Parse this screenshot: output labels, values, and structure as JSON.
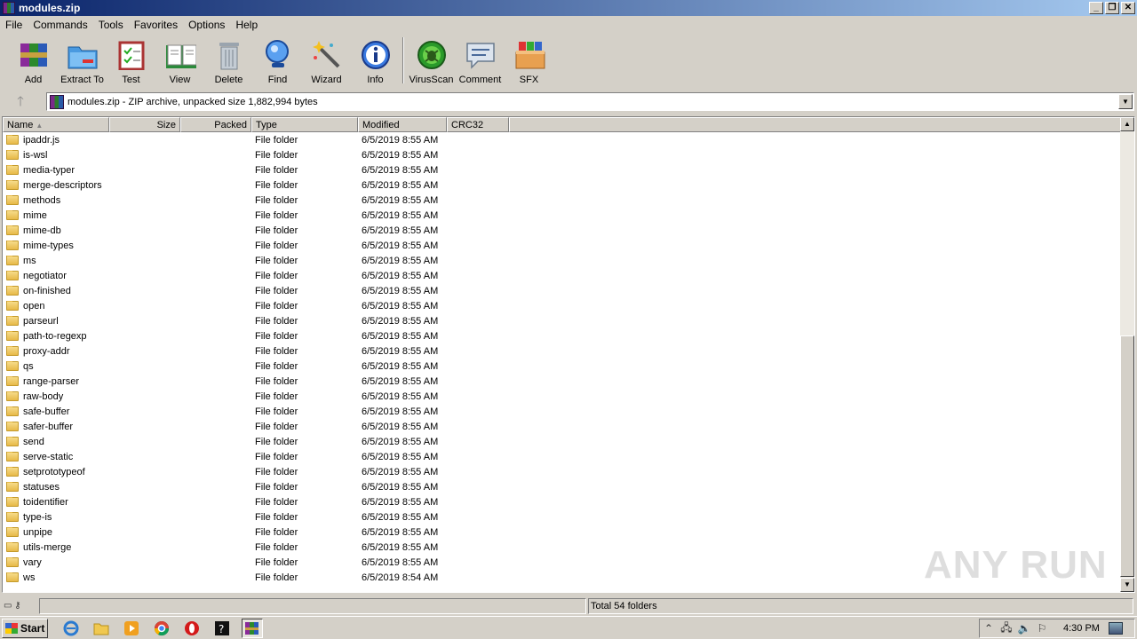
{
  "window": {
    "title": "modules.zip"
  },
  "menu": [
    "File",
    "Commands",
    "Tools",
    "Favorites",
    "Options",
    "Help"
  ],
  "toolbar": [
    {
      "label": "Add",
      "icon": "add-archive-icon"
    },
    {
      "label": "Extract To",
      "icon": "extract-folder-icon"
    },
    {
      "label": "Test",
      "icon": "test-checklist-icon"
    },
    {
      "label": "View",
      "icon": "view-book-icon"
    },
    {
      "label": "Delete",
      "icon": "trash-can-icon"
    },
    {
      "label": "Find",
      "icon": "magnifier-icon"
    },
    {
      "label": "Wizard",
      "icon": "magic-wand-icon"
    },
    {
      "label": "Info",
      "icon": "info-icon"
    },
    {
      "label": "VirusScan",
      "icon": "virus-bug-icon"
    },
    {
      "label": "Comment",
      "icon": "comment-icon"
    },
    {
      "label": "SFX",
      "icon": "sfx-box-icon"
    }
  ],
  "address": {
    "text": "modules.zip - ZIP archive, unpacked size 1,882,994 bytes"
  },
  "columns": [
    "Name",
    "Size",
    "Packed",
    "Type",
    "Modified",
    "CRC32"
  ],
  "files": [
    {
      "name": "ipaddr.js",
      "type": "File folder",
      "modified": "6/5/2019 8:55 AM"
    },
    {
      "name": "is-wsl",
      "type": "File folder",
      "modified": "6/5/2019 8:55 AM"
    },
    {
      "name": "media-typer",
      "type": "File folder",
      "modified": "6/5/2019 8:55 AM"
    },
    {
      "name": "merge-descriptors",
      "type": "File folder",
      "modified": "6/5/2019 8:55 AM"
    },
    {
      "name": "methods",
      "type": "File folder",
      "modified": "6/5/2019 8:55 AM"
    },
    {
      "name": "mime",
      "type": "File folder",
      "modified": "6/5/2019 8:55 AM"
    },
    {
      "name": "mime-db",
      "type": "File folder",
      "modified": "6/5/2019 8:55 AM"
    },
    {
      "name": "mime-types",
      "type": "File folder",
      "modified": "6/5/2019 8:55 AM"
    },
    {
      "name": "ms",
      "type": "File folder",
      "modified": "6/5/2019 8:55 AM"
    },
    {
      "name": "negotiator",
      "type": "File folder",
      "modified": "6/5/2019 8:55 AM"
    },
    {
      "name": "on-finished",
      "type": "File folder",
      "modified": "6/5/2019 8:55 AM"
    },
    {
      "name": "open",
      "type": "File folder",
      "modified": "6/5/2019 8:55 AM"
    },
    {
      "name": "parseurl",
      "type": "File folder",
      "modified": "6/5/2019 8:55 AM"
    },
    {
      "name": "path-to-regexp",
      "type": "File folder",
      "modified": "6/5/2019 8:55 AM"
    },
    {
      "name": "proxy-addr",
      "type": "File folder",
      "modified": "6/5/2019 8:55 AM"
    },
    {
      "name": "qs",
      "type": "File folder",
      "modified": "6/5/2019 8:55 AM"
    },
    {
      "name": "range-parser",
      "type": "File folder",
      "modified": "6/5/2019 8:55 AM"
    },
    {
      "name": "raw-body",
      "type": "File folder",
      "modified": "6/5/2019 8:55 AM"
    },
    {
      "name": "safe-buffer",
      "type": "File folder",
      "modified": "6/5/2019 8:55 AM"
    },
    {
      "name": "safer-buffer",
      "type": "File folder",
      "modified": "6/5/2019 8:55 AM"
    },
    {
      "name": "send",
      "type": "File folder",
      "modified": "6/5/2019 8:55 AM"
    },
    {
      "name": "serve-static",
      "type": "File folder",
      "modified": "6/5/2019 8:55 AM"
    },
    {
      "name": "setprototypeof",
      "type": "File folder",
      "modified": "6/5/2019 8:55 AM"
    },
    {
      "name": "statuses",
      "type": "File folder",
      "modified": "6/5/2019 8:55 AM"
    },
    {
      "name": "toidentifier",
      "type": "File folder",
      "modified": "6/5/2019 8:55 AM"
    },
    {
      "name": "type-is",
      "type": "File folder",
      "modified": "6/5/2019 8:55 AM"
    },
    {
      "name": "unpipe",
      "type": "File folder",
      "modified": "6/5/2019 8:55 AM"
    },
    {
      "name": "utils-merge",
      "type": "File folder",
      "modified": "6/5/2019 8:55 AM"
    },
    {
      "name": "vary",
      "type": "File folder",
      "modified": "6/5/2019 8:55 AM"
    },
    {
      "name": "ws",
      "type": "File folder",
      "modified": "6/5/2019 8:54 AM"
    }
  ],
  "status": {
    "total": "Total 54 folders"
  },
  "watermark": "ANY RUN",
  "taskbar": {
    "start": "Start",
    "apps": [
      "internet-explorer-icon",
      "folder-explorer-icon",
      "media-player-icon",
      "chrome-icon",
      "opera-icon",
      "terminal-icon",
      "winrar-icon"
    ],
    "clock": "4:30 PM"
  },
  "colors": {
    "title_gradient_start": "#0a246a",
    "title_gradient_end": "#a6caf0",
    "chrome": "#d4d0c8"
  }
}
